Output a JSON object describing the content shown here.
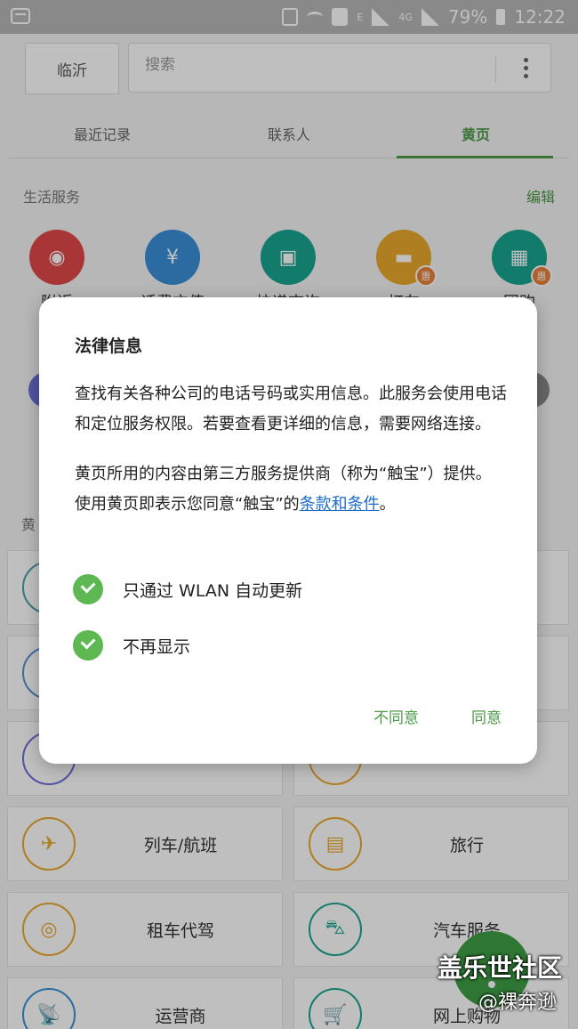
{
  "status_bar": {
    "battery": "79%",
    "time": "12:22",
    "e": "E",
    "lte": "4G"
  },
  "header": {
    "city": "临沂",
    "search_placeholder": "搜索"
  },
  "tabs": [
    {
      "label": "最近记录"
    },
    {
      "label": "联系人"
    },
    {
      "label": "黄页"
    }
  ],
  "life_services": {
    "title": "生活服务",
    "edit": "编辑",
    "items": [
      {
        "label": "附近",
        "color": "#e04848"
      },
      {
        "label": "话费充值",
        "color": "#3a8fd8"
      },
      {
        "label": "快递查询",
        "color": "#1aa58f"
      },
      {
        "label": "打车",
        "color": "#e8a82c",
        "badge": "惠"
      },
      {
        "label": "团购",
        "color": "#1aa58f",
        "badge": "惠"
      }
    ]
  },
  "yellow_pages": {
    "title": "黄",
    "items": [
      {
        "label": "列车/航班",
        "icon": "train-plane-icon"
      },
      {
        "label": "旅行",
        "icon": "suitcase-icon"
      },
      {
        "label": "租车代驾",
        "icon": "steering-wheel-icon"
      },
      {
        "label": "汽车服务",
        "icon": "car-service-icon"
      },
      {
        "label": "运营商",
        "icon": "satellite-dish-icon"
      },
      {
        "label": "网上购物",
        "icon": "shopping-cart-icon"
      }
    ]
  },
  "dialog": {
    "title": "法律信息",
    "paragraph1": "查找有关各种公司的电话号码或实用信息。此服务会使用电话和定位服务权限。若要查看更详细的信息，需要网络连接。",
    "paragraph2_prefix": "黄页所用的内容由第三方服务提供商（称为“触宝”）提供。 使用黄页即表示您同意“触宝”的",
    "terms_link": "条款和条件",
    "paragraph2_suffix": "。",
    "option_wlan": "只通过 WLAN 自动更新",
    "option_dont_show": "不再显示",
    "disagree": "不同意",
    "agree": "同意"
  },
  "watermark": {
    "line1": "盖乐世社区",
    "line2": "@裸奔逊"
  }
}
